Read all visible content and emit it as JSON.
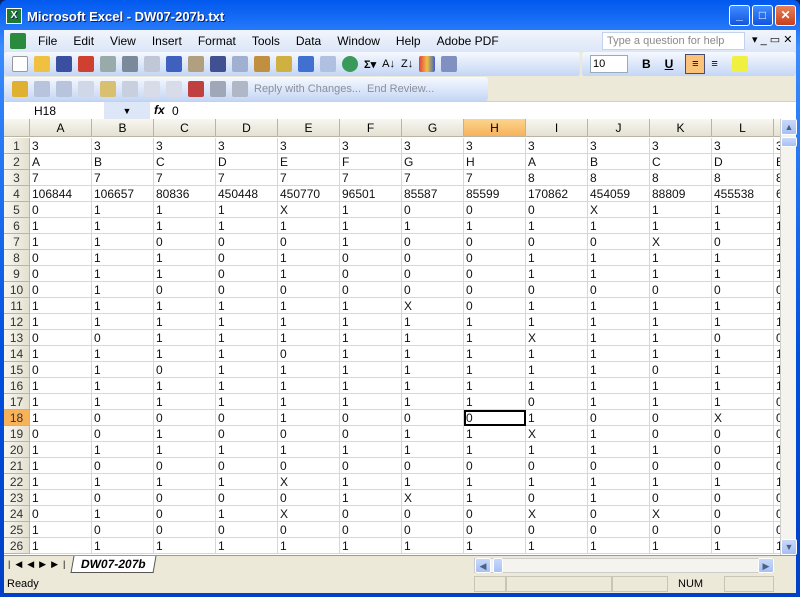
{
  "window": {
    "title": "Microsoft Excel - DW07-207b.txt"
  },
  "menu": [
    "File",
    "Edit",
    "View",
    "Insert",
    "Format",
    "Tools",
    "Data",
    "Window",
    "Help",
    "Adobe PDF"
  ],
  "help_placeholder": "Type a question for help",
  "toolbar": {
    "font_size": "10",
    "bold": "B",
    "underline": "U",
    "reply_with_changes": "Reply with Changes...",
    "end_review": "End Review..."
  },
  "formula_bar": {
    "name_box": "H18",
    "fx": "fx",
    "value": "0"
  },
  "columns": [
    "A",
    "B",
    "C",
    "D",
    "E",
    "F",
    "G",
    "H",
    "I",
    "J",
    "K",
    "L",
    "M"
  ],
  "selected": {
    "column": "H",
    "row": 18
  },
  "rows": [
    [
      "3",
      "3",
      "3",
      "3",
      "3",
      "3",
      "3",
      "3",
      "3",
      "3",
      "3",
      "3",
      "3"
    ],
    [
      "A",
      "B",
      "C",
      "D",
      "E",
      "F",
      "G",
      "H",
      "A",
      "B",
      "C",
      "D",
      "E"
    ],
    [
      "7",
      "7",
      "7",
      "7",
      "7",
      "7",
      "7",
      "7",
      "8",
      "8",
      "8",
      "8",
      "8"
    ],
    [
      "106844",
      "106657",
      "80836",
      "450448",
      "450770",
      "96501",
      "85587",
      "85599",
      "170862",
      "454059",
      "88809",
      "455538",
      "6"
    ],
    [
      "0",
      "1",
      "1",
      "1",
      "X",
      "1",
      "0",
      "0",
      "0",
      "X",
      "1",
      "1",
      "1"
    ],
    [
      "1",
      "1",
      "1",
      "1",
      "1",
      "1",
      "1",
      "1",
      "1",
      "1",
      "1",
      "1",
      "1"
    ],
    [
      "1",
      "1",
      "0",
      "0",
      "0",
      "1",
      "0",
      "0",
      "0",
      "0",
      "X",
      "0",
      "1"
    ],
    [
      "0",
      "1",
      "1",
      "0",
      "1",
      "0",
      "0",
      "0",
      "1",
      "1",
      "1",
      "1",
      "1"
    ],
    [
      "0",
      "1",
      "1",
      "0",
      "1",
      "0",
      "0",
      "0",
      "1",
      "1",
      "1",
      "1",
      "1"
    ],
    [
      "0",
      "1",
      "0",
      "0",
      "0",
      "0",
      "0",
      "0",
      "0",
      "0",
      "0",
      "0",
      "0"
    ],
    [
      "1",
      "1",
      "1",
      "1",
      "1",
      "1",
      "X",
      "0",
      "1",
      "1",
      "1",
      "1",
      "1"
    ],
    [
      "1",
      "1",
      "1",
      "1",
      "1",
      "1",
      "1",
      "1",
      "1",
      "1",
      "1",
      "1",
      "1"
    ],
    [
      "0",
      "0",
      "1",
      "1",
      "1",
      "1",
      "1",
      "1",
      "X",
      "1",
      "1",
      "0",
      "0"
    ],
    [
      "1",
      "1",
      "1",
      "1",
      "0",
      "1",
      "1",
      "1",
      "1",
      "1",
      "1",
      "1",
      "1"
    ],
    [
      "0",
      "1",
      "0",
      "1",
      "1",
      "1",
      "1",
      "1",
      "1",
      "1",
      "0",
      "1",
      "1"
    ],
    [
      "1",
      "1",
      "1",
      "1",
      "1",
      "1",
      "1",
      "1",
      "1",
      "1",
      "1",
      "1",
      "1"
    ],
    [
      "1",
      "1",
      "1",
      "1",
      "1",
      "1",
      "1",
      "1",
      "0",
      "1",
      "1",
      "1",
      "0"
    ],
    [
      "1",
      "0",
      "0",
      "0",
      "1",
      "0",
      "0",
      "0",
      "1",
      "0",
      "0",
      "X",
      "0"
    ],
    [
      "0",
      "0",
      "1",
      "0",
      "0",
      "0",
      "1",
      "1",
      "X",
      "1",
      "0",
      "0",
      "0"
    ],
    [
      "1",
      "1",
      "1",
      "1",
      "1",
      "1",
      "1",
      "1",
      "1",
      "1",
      "1",
      "0",
      "1"
    ],
    [
      "1",
      "0",
      "0",
      "0",
      "0",
      "0",
      "0",
      "0",
      "0",
      "0",
      "0",
      "0",
      "0"
    ],
    [
      "1",
      "1",
      "1",
      "1",
      "X",
      "1",
      "1",
      "1",
      "1",
      "1",
      "1",
      "1",
      "1"
    ],
    [
      "1",
      "0",
      "0",
      "0",
      "0",
      "1",
      "X",
      "1",
      "0",
      "1",
      "0",
      "0",
      "0"
    ],
    [
      "0",
      "1",
      "0",
      "1",
      "X",
      "0",
      "0",
      "0",
      "X",
      "0",
      "X",
      "0",
      "0"
    ],
    [
      "1",
      "0",
      "0",
      "0",
      "0",
      "0",
      "0",
      "0",
      "0",
      "0",
      "0",
      "0",
      "0"
    ],
    [
      "1",
      "1",
      "1",
      "1",
      "1",
      "1",
      "1",
      "1",
      "1",
      "1",
      "1",
      "1",
      "1"
    ]
  ],
  "sheet_tab": "DW07-207b",
  "status": {
    "ready": "Ready",
    "num": "NUM"
  }
}
